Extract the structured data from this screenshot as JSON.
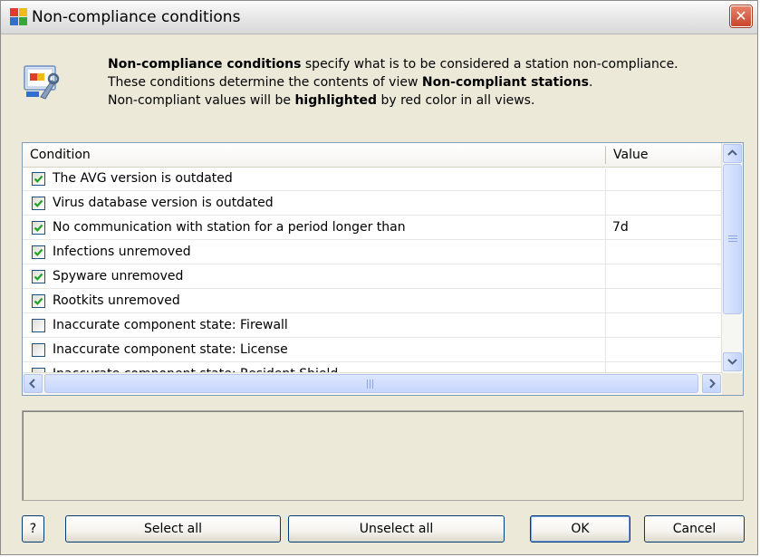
{
  "window": {
    "title": "Non-compliance conditions",
    "close_glyph": "✕"
  },
  "info": {
    "icon": "settings-wrench-icon",
    "line1_bold": "Non-compliance conditions",
    "line1_rest": " specify what is to be considered a station non-compliance.",
    "line2_pre": "These conditions determine the contents of view ",
    "line2_bold": "Non-compliant stations",
    "line2_post": ".",
    "line3_pre": "Non-compliant values will be ",
    "line3_bold": "highlighted",
    "line3_post": " by red color in all views."
  },
  "table": {
    "columns": [
      "Condition",
      "Value"
    ],
    "rows": [
      {
        "label": "The AVG version is outdated",
        "value": "",
        "checked": true
      },
      {
        "label": "Virus database version is outdated",
        "value": "",
        "checked": true
      },
      {
        "label": "No communication with station for a period longer than",
        "value": "7d",
        "checked": true
      },
      {
        "label": "Infections unremoved",
        "value": "",
        "checked": true
      },
      {
        "label": "Spyware unremoved",
        "value": "",
        "checked": true
      },
      {
        "label": "Rootkits unremoved",
        "value": "",
        "checked": true
      },
      {
        "label": "Inaccurate component state: Firewall",
        "value": "",
        "checked": false
      },
      {
        "label": "Inaccurate component state: License",
        "value": "",
        "checked": false
      },
      {
        "label": "Inaccurate component state: Resident Shield",
        "value": "",
        "checked": false
      }
    ]
  },
  "buttons": {
    "help": "?",
    "select_all": "Select all",
    "unselect_all": "Unselect all",
    "ok": "OK",
    "cancel": "Cancel"
  },
  "colors": {
    "check": "#21a121",
    "checkbox_border": "#1c5180",
    "close_button": "#c8452b"
  }
}
